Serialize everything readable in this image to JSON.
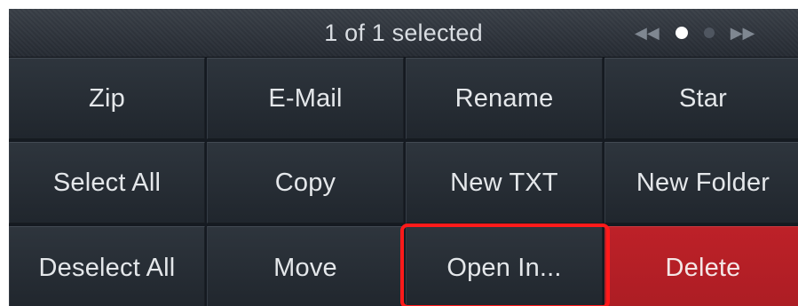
{
  "header": {
    "title": "1 of 1 selected",
    "pager": {
      "prev_icon": "double-chevron-left-icon",
      "next_icon": "double-chevron-right-icon",
      "prev_glyph": "◀◀",
      "next_glyph": "▶▶",
      "page_count": 2,
      "current_page": 1
    }
  },
  "actions": {
    "zip": "Zip",
    "email": "E-Mail",
    "rename": "Rename",
    "star": "Star",
    "select_all": "Select All",
    "copy": "Copy",
    "new_txt": "New TXT",
    "new_folder": "New Folder",
    "deselect_all": "Deselect All",
    "move": "Move",
    "open_in": "Open In...",
    "delete": "Delete"
  },
  "colors": {
    "panel_background": "#151a21",
    "button_text": "#e4e7ea",
    "delete_background": "#b51f26",
    "highlight_outline": "#ff1a1a"
  }
}
